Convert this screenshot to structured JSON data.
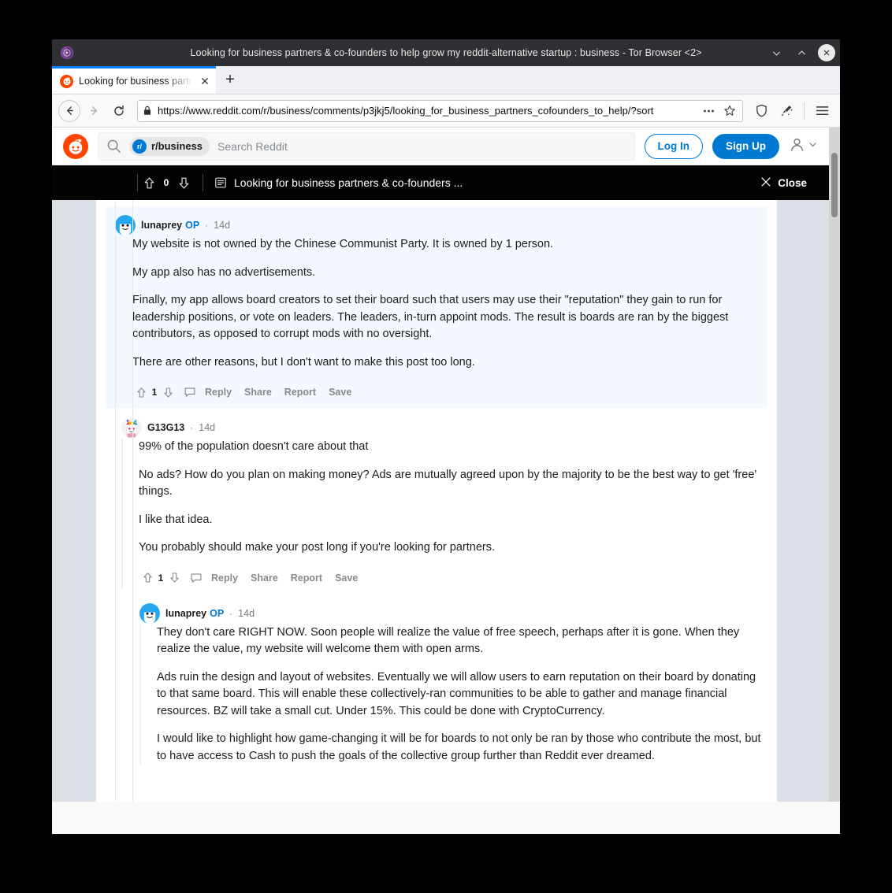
{
  "window": {
    "title": "Looking for business partners & co-founders to help grow my reddit-alternative startup : business - Tor Browser <2>",
    "minimize_icon": "chevron-down-icon",
    "maximize_icon": "chevron-up-icon",
    "close_icon": "close-icon"
  },
  "tabs": {
    "active_title": "Looking for business partner",
    "close_label": "✕",
    "newtab_label": "+"
  },
  "navbar": {
    "back_icon": "←",
    "forward_icon": "→",
    "reload_icon": "↻",
    "url": "https://www.reddit.com/r/business/comments/p3jkj5/looking_for_business_partners_cofounders_to_help/?sort",
    "page_actions_icon": "ellipsis-icon",
    "bookmark_icon": "star-icon",
    "shield_icon": "shield-icon",
    "newidentity_icon": "broom-icon",
    "menu_icon": "hamburger-icon"
  },
  "reddit_header": {
    "logo_icon": "reddit-snoo-icon",
    "search": {
      "icon": "search-icon",
      "chip_label": "r/business",
      "chip_icon": "subreddit-avatar-icon",
      "placeholder": "Search Reddit",
      "value": ""
    },
    "login_label": "Log In",
    "signup_label": "Sign Up",
    "user_icon": "user-avatar-icon",
    "user_chevron_icon": "chevron-down-icon",
    "accent_color": "#0079d3",
    "brand_color": "#ff4500"
  },
  "postbar": {
    "upvote_icon": "upvote-arrow-icon",
    "score": "0",
    "downvote_icon": "downvote-arrow-icon",
    "post_icon": "post-lines-icon",
    "title": "Looking for business partners & co-founders ...",
    "close_icon": "close-x-icon",
    "close_label": "Close",
    "background_color": "#030303"
  },
  "comments": [
    {
      "id": "comment-1",
      "avatar": "snoo-blue-avatar",
      "author": "lunaprey",
      "op_badge": "OP",
      "separator": "·",
      "timestamp": "14d",
      "highlighted": true,
      "paragraphs": [
        "My website is not owned by the Chinese Communist Party. It is owned by 1 person.",
        "My app also has no advertisements.",
        "Finally, my app allows board creators to set their board such that users may use their \"reputation\" they gain to run for leadership positions, or vote on leaders. The leaders, in-turn appoint mods. The result is boards are ran by the biggest contributors, as opposed to corrupt mods with no oversight.",
        "There are other reasons, but I don't want to make this post too long."
      ],
      "actions": {
        "upvote_icon": "upvote-arrow-icon",
        "score": "1",
        "downvote_icon": "downvote-arrow-icon",
        "comment_icon": "comment-bubble-icon",
        "reply": "Reply",
        "share": "Share",
        "report": "Report",
        "save": "Save"
      }
    },
    {
      "id": "comment-2",
      "avatar": "snoo-rainbow-avatar",
      "author": "G13G13",
      "op_badge": "",
      "separator": "·",
      "timestamp": "14d",
      "highlighted": false,
      "paragraphs": [
        "99% of the population doesn't care about that",
        "No ads? How do you plan on making money? Ads are mutually agreed upon by the majority to be the best way to get 'free' things.",
        "I like that idea.",
        "You probably should make your post long if you're looking for partners."
      ],
      "actions": {
        "upvote_icon": "upvote-arrow-icon",
        "score": "1",
        "downvote_icon": "downvote-arrow-icon",
        "comment_icon": "comment-bubble-icon",
        "reply": "Reply",
        "share": "Share",
        "report": "Report",
        "save": "Save"
      }
    },
    {
      "id": "comment-3",
      "avatar": "snoo-blue-avatar",
      "author": "lunaprey",
      "op_badge": "OP",
      "separator": "·",
      "timestamp": "14d",
      "highlighted": false,
      "paragraphs": [
        "They don't care RIGHT NOW. Soon people will realize the value of free speech, perhaps after it is gone. When they realize the value, my website will welcome them with open arms.",
        "Ads ruin the design and layout of websites. Eventually we will allow users to earn reputation on their board by donating to that same board. This will enable these collectively-ran communities to be able to gather and manage financial resources. BZ will take a small cut. Under 15%. This could be done with CryptoCurrency.",
        "I would like to highlight how game-changing it will be for boards to not only be ran by those who contribute the most, but to have access to Cash to push the goals of the collective group further than Reddit ever dreamed."
      ],
      "actions": null
    }
  ],
  "scrollbar": {
    "thumb_name": "vertical-scrollbar-thumb"
  }
}
